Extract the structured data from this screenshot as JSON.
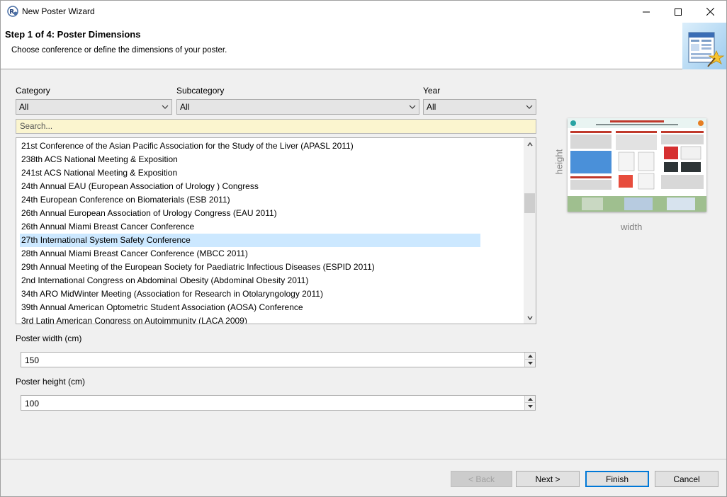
{
  "window": {
    "title": "New Poster Wizard"
  },
  "header": {
    "step_title": "Step 1 of 4: Poster Dimensions",
    "description": "Choose conference or define the dimensions of your poster."
  },
  "filters": {
    "category": {
      "label": "Category",
      "value": "All"
    },
    "subcategory": {
      "label": "Subcategory",
      "value": "All"
    },
    "year": {
      "label": "Year",
      "value": "All"
    }
  },
  "search": {
    "placeholder": "Search..."
  },
  "conferences": {
    "items": [
      "21st Conference of the Asian Pacific Association for the Study of the Liver (APASL 2011)",
      "238th ACS National Meeting & Exposition",
      "241st ACS National Meeting & Exposition",
      "24th Annual EAU (European Association of Urology ) Congress",
      "24th European Conference on Biomaterials (ESB 2011)",
      "26th Annual European Association of Urology Congress (EAU 2011)",
      "26th Annual Miami Breast Cancer Conference",
      "27th International System Safety Conference",
      "28th Annual Miami Breast Cancer Conference (MBCC 2011)",
      "29th Annual Meeting of the European Society for Paediatric Infectious Diseases (ESPID 2011)",
      "2nd International Congress on Abdominal Obesity (Abdominal Obesity 2011)",
      "34th ARO MidWinter Meeting (Association for Research in Otolaryngology 2011)",
      "39th Annual American Optometric Student Association (AOSA) Conference",
      "3rd Latin American Congress on Autoimmunity (LACA 2009)"
    ],
    "selected_index": 7
  },
  "dimensions": {
    "width": {
      "label": "Poster width (cm)",
      "value": "150"
    },
    "height": {
      "label": "Poster height (cm)",
      "value": "100"
    }
  },
  "preview": {
    "height_label": "height",
    "width_label": "width"
  },
  "buttons": {
    "back": "< Back",
    "next": "Next >",
    "finish": "Finish",
    "cancel": "Cancel"
  },
  "colors": {
    "selection": "#cce8ff",
    "search_bg": "#fbf5cf",
    "default_button_border": "#0078d7"
  }
}
